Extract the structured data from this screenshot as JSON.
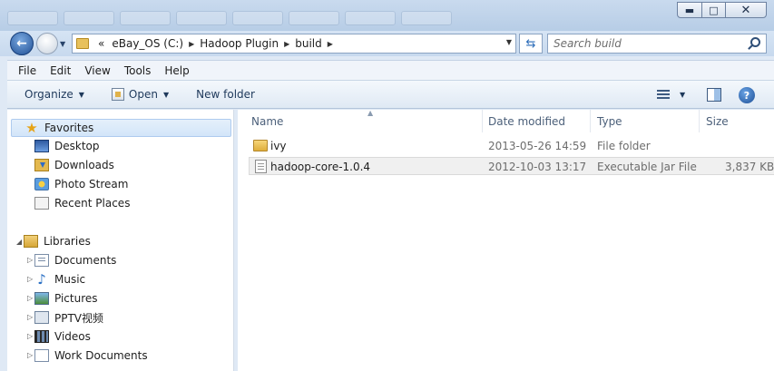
{
  "window": {
    "close_glyph": "✕",
    "maximize_glyph": "□",
    "minimize_glyph": "▬"
  },
  "address": {
    "overflow": "«",
    "crumbs": [
      "eBay_OS (C:)",
      "Hadoop Plugin",
      "build"
    ]
  },
  "search": {
    "placeholder": "Search build"
  },
  "menu": [
    "File",
    "Edit",
    "View",
    "Tools",
    "Help"
  ],
  "toolbar": {
    "organize": "Organize",
    "open": "Open",
    "new_folder": "New folder"
  },
  "nav": {
    "favorites": {
      "label": "Favorites",
      "items": [
        "Desktop",
        "Downloads",
        "Photo Stream",
        "Recent Places"
      ]
    },
    "libraries": {
      "label": "Libraries",
      "items": [
        "Documents",
        "Music",
        "Pictures",
        "PPTV视频",
        "Videos",
        "Work Documents"
      ]
    }
  },
  "columns": {
    "name": "Name",
    "date": "Date modified",
    "type": "Type",
    "size": "Size"
  },
  "files": [
    {
      "name": "ivy",
      "date": "2013-05-26 14:59",
      "type": "File folder",
      "size": ""
    },
    {
      "name": "hadoop-core-1.0.4",
      "date": "2012-10-03 13:17",
      "type": "Executable Jar File",
      "size": "3,837 KB"
    }
  ],
  "colors": {
    "accent": "#1e395b",
    "selection": "#d3e5f9"
  }
}
